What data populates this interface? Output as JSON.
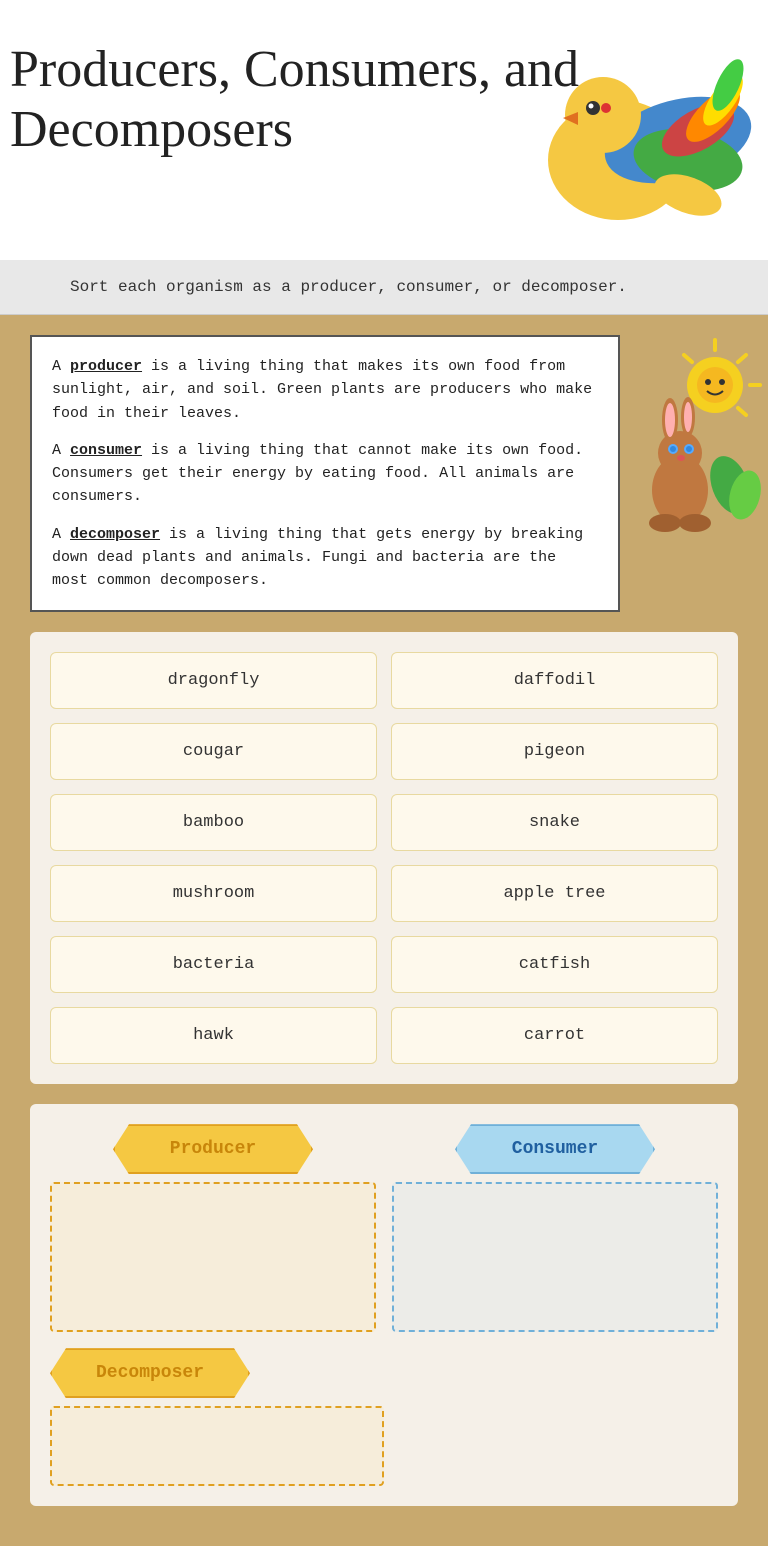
{
  "page": {
    "title_line1": "Producers, Consumers, and",
    "title_line2": "Decomposers"
  },
  "instruction": {
    "text": "Sort each organism as a producer, consumer, or decomposer."
  },
  "definitions": {
    "producer": {
      "term": "producer",
      "description": "A producer is a living thing that makes its own food from sunlight, air, and soil.  Green plants are producers who make food in their leaves."
    },
    "consumer": {
      "term": "consumer",
      "description": "A consumer is a living thing that cannot make its own food.  Consumers get their energy by eating food.  All animals are consumers."
    },
    "decomposer": {
      "term": "decomposer",
      "description": "A decomposer is a living thing that gets energy by breaking down dead plants and animals.  Fungi and bacteria are the most common decomposers."
    }
  },
  "organisms": [
    {
      "id": "dragonfly",
      "name": "dragonfly"
    },
    {
      "id": "daffodil",
      "name": "daffodil"
    },
    {
      "id": "cougar",
      "name": "cougar"
    },
    {
      "id": "pigeon",
      "name": "pigeon"
    },
    {
      "id": "bamboo",
      "name": "bamboo"
    },
    {
      "id": "snake",
      "name": "snake"
    },
    {
      "id": "mushroom",
      "name": "mushroom"
    },
    {
      "id": "apple-tree",
      "name": "apple tree"
    },
    {
      "id": "bacteria",
      "name": "bacteria"
    },
    {
      "id": "catfish",
      "name": "catfish"
    },
    {
      "id": "hawk",
      "name": "hawk"
    },
    {
      "id": "carrot",
      "name": "carrot"
    }
  ],
  "categories": {
    "producer": {
      "label": "Producer"
    },
    "consumer": {
      "label": "Consumer"
    },
    "decomposer": {
      "label": "Decomposer"
    }
  }
}
